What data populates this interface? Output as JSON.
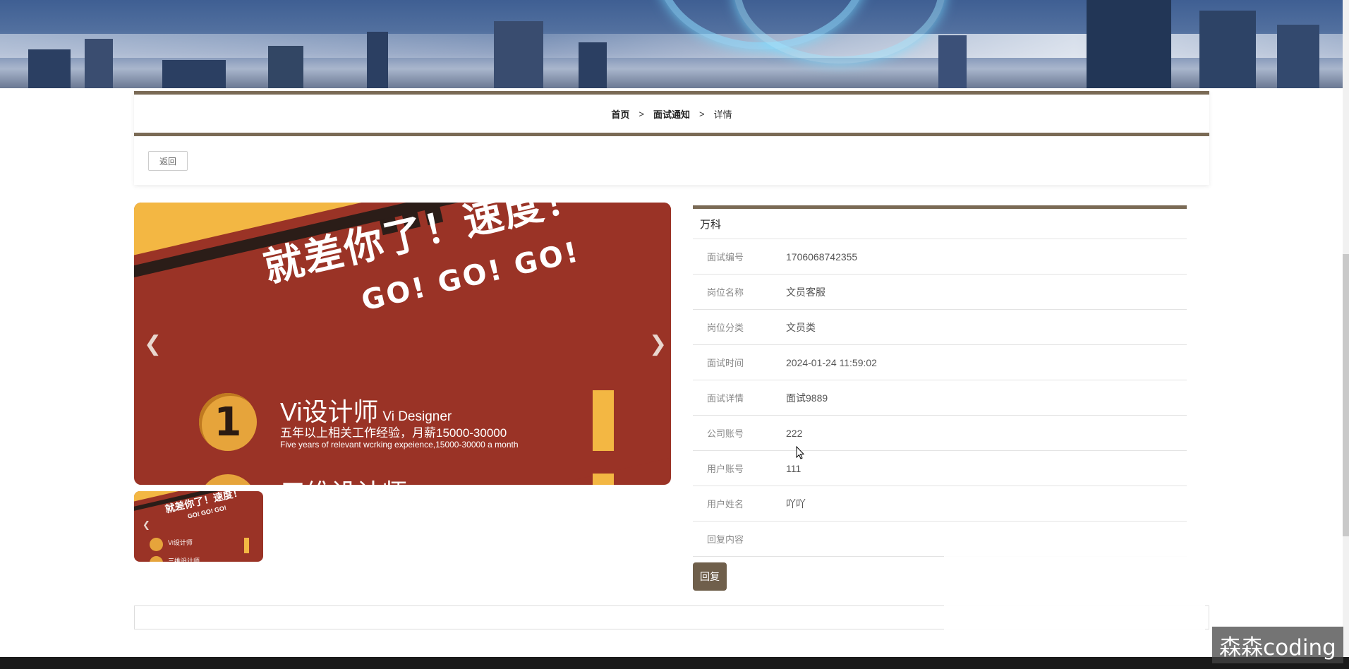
{
  "breadcrumb": {
    "home": "首页",
    "section": "面试通知",
    "current": "详情",
    "separator": ">"
  },
  "toolbar": {
    "back_label": "返回"
  },
  "carousel": {
    "headline": "就差你了！速度！",
    "tagline": "GO! GO! GO!",
    "item_number": "1",
    "job_title": "Vi设计师",
    "job_title_en": "Vi Designer",
    "job_desc": "五年以上相关工作经验，月薪15000-30000",
    "job_desc_en": "Five years of relevant wcrking expeience,15000-30000 a month",
    "next_job_title": "三维设计师",
    "prev_icon": "chevron-left-icon",
    "next_icon": "chevron-right-icon"
  },
  "detail": {
    "company": "万科",
    "rows": [
      {
        "label": "面试编号",
        "value": "1706068742355"
      },
      {
        "label": "岗位名称",
        "value": "文员客服"
      },
      {
        "label": "岗位分类",
        "value": "文员类"
      },
      {
        "label": "面试时间",
        "value": "2024-01-24 11:59:02"
      },
      {
        "label": "面试详情",
        "value": "面试9889"
      },
      {
        "label": "公司账号",
        "value": "222"
      },
      {
        "label": "用户账号",
        "value": "111"
      },
      {
        "label": "用户姓名",
        "value": "吖吖"
      },
      {
        "label": "回复内容",
        "value": ""
      }
    ],
    "reply_label": "回复"
  },
  "watermark": "森森coding",
  "colors": {
    "accent": "#7a6a55",
    "button": "#6f5f4b",
    "poster_red": "#9a3326",
    "poster_yellow": "#f3b743"
  }
}
